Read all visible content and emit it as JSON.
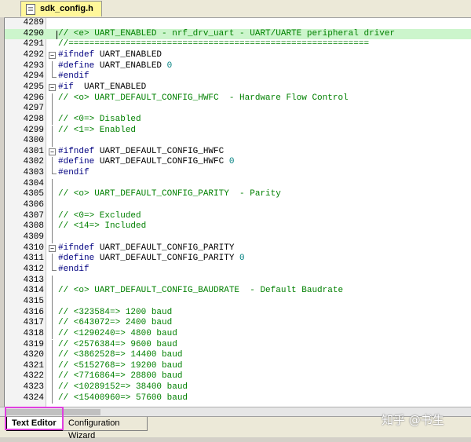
{
  "file_tab": {
    "name": "sdk_config.h"
  },
  "lines": [
    {
      "n": "4289",
      "parts": []
    },
    {
      "n": "4290",
      "parts": [
        [
          "cmt",
          "// <e> UART_ENABLED - nrf_drv_uart - UART/UARTE peripheral driver"
        ]
      ],
      "hl": true
    },
    {
      "n": "4291",
      "parts": [
        [
          "cmt",
          "//=========================================================="
        ]
      ]
    },
    {
      "n": "4292",
      "fold": "open",
      "parts": [
        [
          "kw",
          "#ifndef "
        ],
        [
          "txt",
          "UART_ENABLED"
        ]
      ]
    },
    {
      "n": "4293",
      "fold": "line",
      "parts": [
        [
          "kw",
          "#define "
        ],
        [
          "txt",
          "UART_ENABLED "
        ],
        [
          "num",
          "0"
        ]
      ]
    },
    {
      "n": "4294",
      "fold": "end",
      "parts": [
        [
          "kw",
          "#endif"
        ]
      ]
    },
    {
      "n": "4295",
      "fold": "open",
      "parts": [
        [
          "kw",
          "#if  "
        ],
        [
          "txt",
          "UART_ENABLED"
        ]
      ]
    },
    {
      "n": "4296",
      "fold": "line",
      "parts": [
        [
          "cmt",
          "// <o> UART_DEFAULT_CONFIG_HWFC  - Hardware Flow Control"
        ]
      ]
    },
    {
      "n": "4297",
      "fold": "line",
      "parts": []
    },
    {
      "n": "4298",
      "fold": "line",
      "parts": [
        [
          "cmt",
          "// <0=> Disabled"
        ]
      ]
    },
    {
      "n": "4299",
      "fold": "line",
      "parts": [
        [
          "cmt",
          "// <1=> Enabled"
        ]
      ]
    },
    {
      "n": "4300",
      "fold": "line",
      "parts": []
    },
    {
      "n": "4301",
      "fold": "open",
      "parts": [
        [
          "kw",
          "#ifndef "
        ],
        [
          "txt",
          "UART_DEFAULT_CONFIG_HWFC"
        ]
      ]
    },
    {
      "n": "4302",
      "fold": "line",
      "parts": [
        [
          "kw",
          "#define "
        ],
        [
          "txt",
          "UART_DEFAULT_CONFIG_HWFC "
        ],
        [
          "num",
          "0"
        ]
      ]
    },
    {
      "n": "4303",
      "fold": "end",
      "parts": [
        [
          "kw",
          "#endif"
        ]
      ]
    },
    {
      "n": "4304",
      "fold": "line",
      "parts": []
    },
    {
      "n": "4305",
      "fold": "line",
      "parts": [
        [
          "cmt",
          "// <o> UART_DEFAULT_CONFIG_PARITY  - Parity"
        ]
      ]
    },
    {
      "n": "4306",
      "fold": "line",
      "parts": []
    },
    {
      "n": "4307",
      "fold": "line",
      "parts": [
        [
          "cmt",
          "// <0=> Excluded"
        ]
      ]
    },
    {
      "n": "4308",
      "fold": "line",
      "parts": [
        [
          "cmt",
          "// <14=> Included"
        ]
      ]
    },
    {
      "n": "4309",
      "fold": "line",
      "parts": []
    },
    {
      "n": "4310",
      "fold": "open",
      "parts": [
        [
          "kw",
          "#ifndef "
        ],
        [
          "txt",
          "UART_DEFAULT_CONFIG_PARITY"
        ]
      ]
    },
    {
      "n": "4311",
      "fold": "line",
      "parts": [
        [
          "kw",
          "#define "
        ],
        [
          "txt",
          "UART_DEFAULT_CONFIG_PARITY "
        ],
        [
          "num",
          "0"
        ]
      ]
    },
    {
      "n": "4312",
      "fold": "end",
      "parts": [
        [
          "kw",
          "#endif"
        ]
      ]
    },
    {
      "n": "4313",
      "fold": "line",
      "parts": []
    },
    {
      "n": "4314",
      "fold": "line",
      "parts": [
        [
          "cmt",
          "// <o> UART_DEFAULT_CONFIG_BAUDRATE  - Default Baudrate"
        ]
      ]
    },
    {
      "n": "4315",
      "fold": "line",
      "parts": []
    },
    {
      "n": "4316",
      "fold": "line",
      "parts": [
        [
          "cmt",
          "// <323584=> 1200 baud"
        ]
      ]
    },
    {
      "n": "4317",
      "fold": "line",
      "parts": [
        [
          "cmt",
          "// <643072=> 2400 baud"
        ]
      ]
    },
    {
      "n": "4318",
      "fold": "line",
      "parts": [
        [
          "cmt",
          "// <1290240=> 4800 baud"
        ]
      ]
    },
    {
      "n": "4319",
      "fold": "line",
      "parts": [
        [
          "cmt",
          "// <2576384=> 9600 baud"
        ]
      ]
    },
    {
      "n": "4320",
      "fold": "line",
      "parts": [
        [
          "cmt",
          "// <3862528=> 14400 baud"
        ]
      ]
    },
    {
      "n": "4321",
      "fold": "line",
      "parts": [
        [
          "cmt",
          "// <5152768=> 19200 baud"
        ]
      ]
    },
    {
      "n": "4322",
      "fold": "line",
      "parts": [
        [
          "cmt",
          "// <7716864=> 28800 baud"
        ]
      ]
    },
    {
      "n": "4323",
      "fold": "line",
      "parts": [
        [
          "cmt",
          "// <10289152=> 38400 baud"
        ]
      ]
    },
    {
      "n": "4324",
      "fold": "line",
      "parts": [
        [
          "cmt",
          "// <15400960=> 57600 baud"
        ]
      ]
    }
  ],
  "bottom_tabs": {
    "active": "Text Editor",
    "inactive": "Configuration Wizard"
  },
  "watermark": "知乎 @书生"
}
